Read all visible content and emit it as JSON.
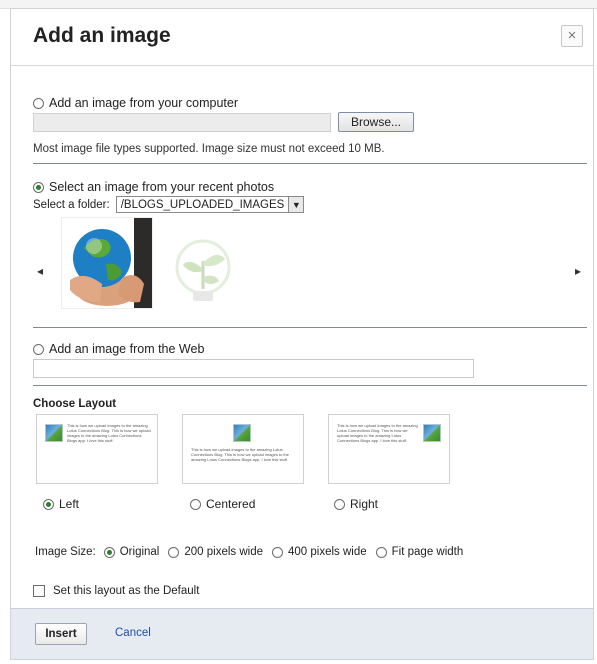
{
  "dialog": {
    "title": "Add an image",
    "close_glyph": "×"
  },
  "computer": {
    "option_label": "Add an image from your computer",
    "browse_label": "Browse...",
    "note": "Most image file types supported. Image size must not exceed 10 MB."
  },
  "recent": {
    "option_label": "Select an image from your recent photos",
    "folder_label": "Select a folder:",
    "folder_value": "/BLOGS_UPLOADED_IMAGES",
    "prev_glyph": "◂",
    "next_glyph": "▸"
  },
  "web": {
    "option_label": "Add an image from the Web",
    "url_value": ""
  },
  "layout": {
    "heading": "Choose Layout",
    "sample_text": "This is how we upload images to the amazing Lotus Connections Blog. This is how we upload images to the amazing Lotus Connections Blogs app. I love this stuff.",
    "options": [
      {
        "label": "Left",
        "selected": true
      },
      {
        "label": "Centered",
        "selected": false
      },
      {
        "label": "Right",
        "selected": false
      }
    ]
  },
  "image_size": {
    "label": "Image Size:",
    "options": [
      {
        "label": "Original",
        "selected": true
      },
      {
        "label": "200 pixels wide",
        "selected": false
      },
      {
        "label": "400 pixels wide",
        "selected": false
      },
      {
        "label": "Fit page width",
        "selected": false
      }
    ]
  },
  "default_checkbox": {
    "label": "Set this layout as the Default",
    "checked": false
  },
  "footer": {
    "insert_label": "Insert",
    "cancel_label": "Cancel"
  },
  "colors": {
    "radio_selected": "#2f7d2f",
    "link": "#1f4fa8",
    "footer_bg": "#e6ebf2"
  }
}
